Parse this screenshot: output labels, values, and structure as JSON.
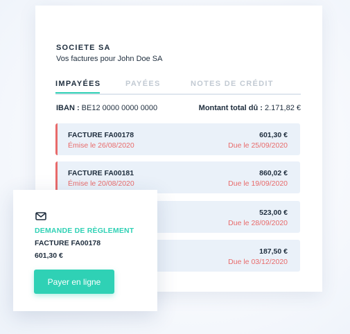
{
  "company": {
    "name": "SOCIETE SA",
    "subtitle": "Vos factures pour John Doe SA"
  },
  "tabs": [
    {
      "label": "IMPAYÉES",
      "active": true
    },
    {
      "label": "PAYÉES",
      "active": false
    },
    {
      "label": "NOTES DE CRÉDIT",
      "active": false
    }
  ],
  "summary": {
    "iban_label": "IBAN :",
    "iban_value": "BE12 0000 0000 0000",
    "total_label": "Montant total dû :",
    "total_value": "2.171,82 €"
  },
  "invoices": [
    {
      "number": "FACTURE FA00178",
      "issued": "Émise le 26/08/2020",
      "amount": "601,30 €",
      "due": "Due le 25/09/2020"
    },
    {
      "number": "FACTURE FA00181",
      "issued": "Émise le 20/08/2020",
      "amount": "860,02 €",
      "due": "Due le 19/09/2020"
    },
    {
      "amount": "523,00 €",
      "due": "Due le 28/09/2020"
    },
    {
      "amount": "187,50 €",
      "due": "Due le 03/12/2020"
    }
  ],
  "payment_request": {
    "icon": "envelope-icon",
    "label": "DEMANDE DE RÈGLEMENT",
    "invoice": "FACTURE FA00178",
    "amount": "601,30 €",
    "button_label": "Payer en ligne"
  },
  "colors": {
    "accent": "#2fd1b5",
    "overdue": "#e86a6a",
    "invoice_bg": "#eaf1f9",
    "text": "#1e2d3d",
    "inactive_tab": "#c2cad3"
  }
}
